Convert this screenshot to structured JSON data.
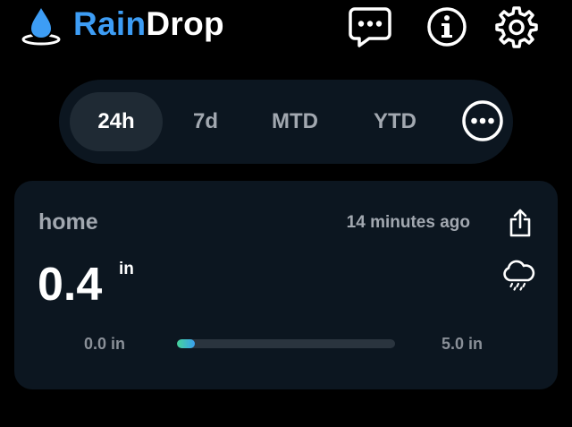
{
  "header": {
    "app_name_part1": "Rain",
    "app_name_part2": "Drop",
    "icons": {
      "logo": "water-drop-icon",
      "feedback": "chat-bubble-icon",
      "info": "info-icon",
      "settings": "gear-icon"
    }
  },
  "period_selector": {
    "options": [
      {
        "label": "24h",
        "active": true
      },
      {
        "label": "7d",
        "active": false
      },
      {
        "label": "MTD",
        "active": false
      },
      {
        "label": "YTD",
        "active": false
      }
    ],
    "more_icon": "more-horizontal-icon"
  },
  "card": {
    "station": "home",
    "updated": "14 minutes ago",
    "value": "0.4",
    "unit": "in",
    "range_min": "0.0 in",
    "range_max": "5.0 in",
    "progress_fraction": 0.08,
    "share_icon": "share-icon",
    "weather_icon": "cloud-rain-icon"
  },
  "colors": {
    "brand_rain": "#3d9df5",
    "brand_drop": "#ffffff",
    "background": "#000000",
    "card": "#0c1620",
    "accent_dot": "#e0432e"
  }
}
